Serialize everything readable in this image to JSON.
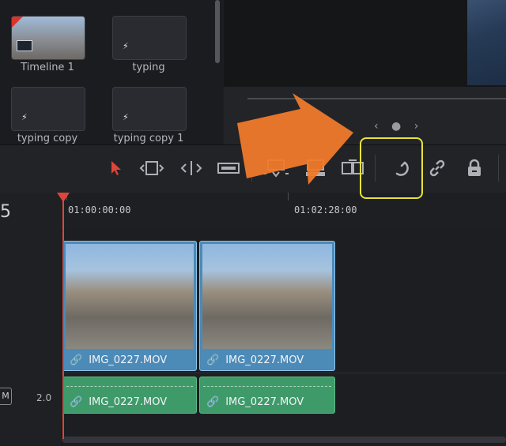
{
  "media_pool": {
    "items": [
      {
        "label": "Timeline 1"
      },
      {
        "label": "typing"
      },
      {
        "label": "typing copy"
      },
      {
        "label": "typing copy 1"
      }
    ]
  },
  "viewer": {
    "page_dots": "‹ ● ›"
  },
  "timeline": {
    "header_number": "5",
    "timecodes": [
      "01:00:00:00",
      "01:02:28:00"
    ],
    "track_volume": "2.0",
    "mute_label": "M",
    "video_clips": [
      {
        "name": "IMG_0227.MOV"
      },
      {
        "name": "IMG_0227.MOV"
      }
    ],
    "audio_clips": [
      {
        "name": "IMG_0227.MOV"
      },
      {
        "name": "IMG_0227.MOV"
      }
    ]
  },
  "colors": {
    "playhead": "#e0453a",
    "video_clip": "#4c8ab8",
    "audio_clip": "#3f9a6a",
    "highlight": "#e7e33b",
    "annotation_arrow": "#f07a2a"
  },
  "toolbar": {
    "icons": [
      "selection-arrow-icon",
      "trim-edit-icon",
      "dynamic-trim-icon",
      "blade-icon",
      "insert-clip-icon",
      "overwrite-clip-icon",
      "replace-clip-icon",
      "snapping-icon",
      "linked-selection-icon",
      "position-lock-icon"
    ]
  }
}
